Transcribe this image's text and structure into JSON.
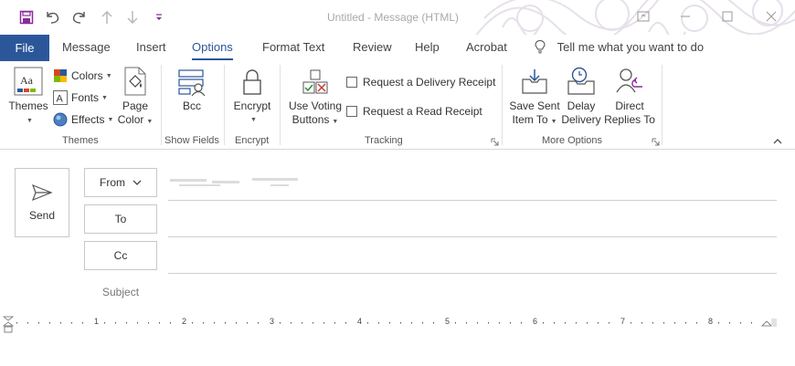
{
  "window": {
    "title": "Untitled  -  Message (HTML)"
  },
  "qat": {
    "icons": [
      "save-icon",
      "undo-icon",
      "redo-icon",
      "up-arrow-icon",
      "down-arrow-icon",
      "customize-qat-icon"
    ]
  },
  "tabs": {
    "file": "File",
    "items": [
      "Message",
      "Insert",
      "Options",
      "Format Text",
      "Review",
      "Help",
      "Acrobat"
    ],
    "active": "Options",
    "tell_me": "Tell me what you want to do"
  },
  "ribbon": {
    "themes_group": {
      "label": "Themes",
      "themes": "Themes",
      "colors": "Colors",
      "fonts": "Fonts",
      "effects": "Effects",
      "page_color_line1": "Page",
      "page_color_line2": "Color"
    },
    "show_fields_group": {
      "label": "Show Fields",
      "bcc": "Bcc"
    },
    "encrypt_group": {
      "label": "Encrypt",
      "encrypt": "Encrypt"
    },
    "tracking_group": {
      "label": "Tracking",
      "voting_line1": "Use Voting",
      "voting_line2": "Buttons",
      "delivery_receipt": "Request a Delivery Receipt",
      "read_receipt": "Request a Read Receipt",
      "delivery_receipt_checked": false,
      "read_receipt_checked": false
    },
    "more_options_group": {
      "label": "More Options",
      "save_sent_line1": "Save Sent",
      "save_sent_line2": "Item To",
      "delay_line1": "Delay",
      "delay_line2": "Delivery",
      "direct_line1": "Direct",
      "direct_line2": "Replies To"
    }
  },
  "compose": {
    "send": "Send",
    "from": "From",
    "to": "To",
    "cc": "Cc",
    "subject": "Subject"
  },
  "ruler": {
    "numbers": [
      "1",
      "2",
      "3",
      "4",
      "5",
      "6",
      "7",
      "8"
    ]
  },
  "colors": {
    "accent": "#2b579a",
    "qat_save": "#8a2a9b"
  }
}
